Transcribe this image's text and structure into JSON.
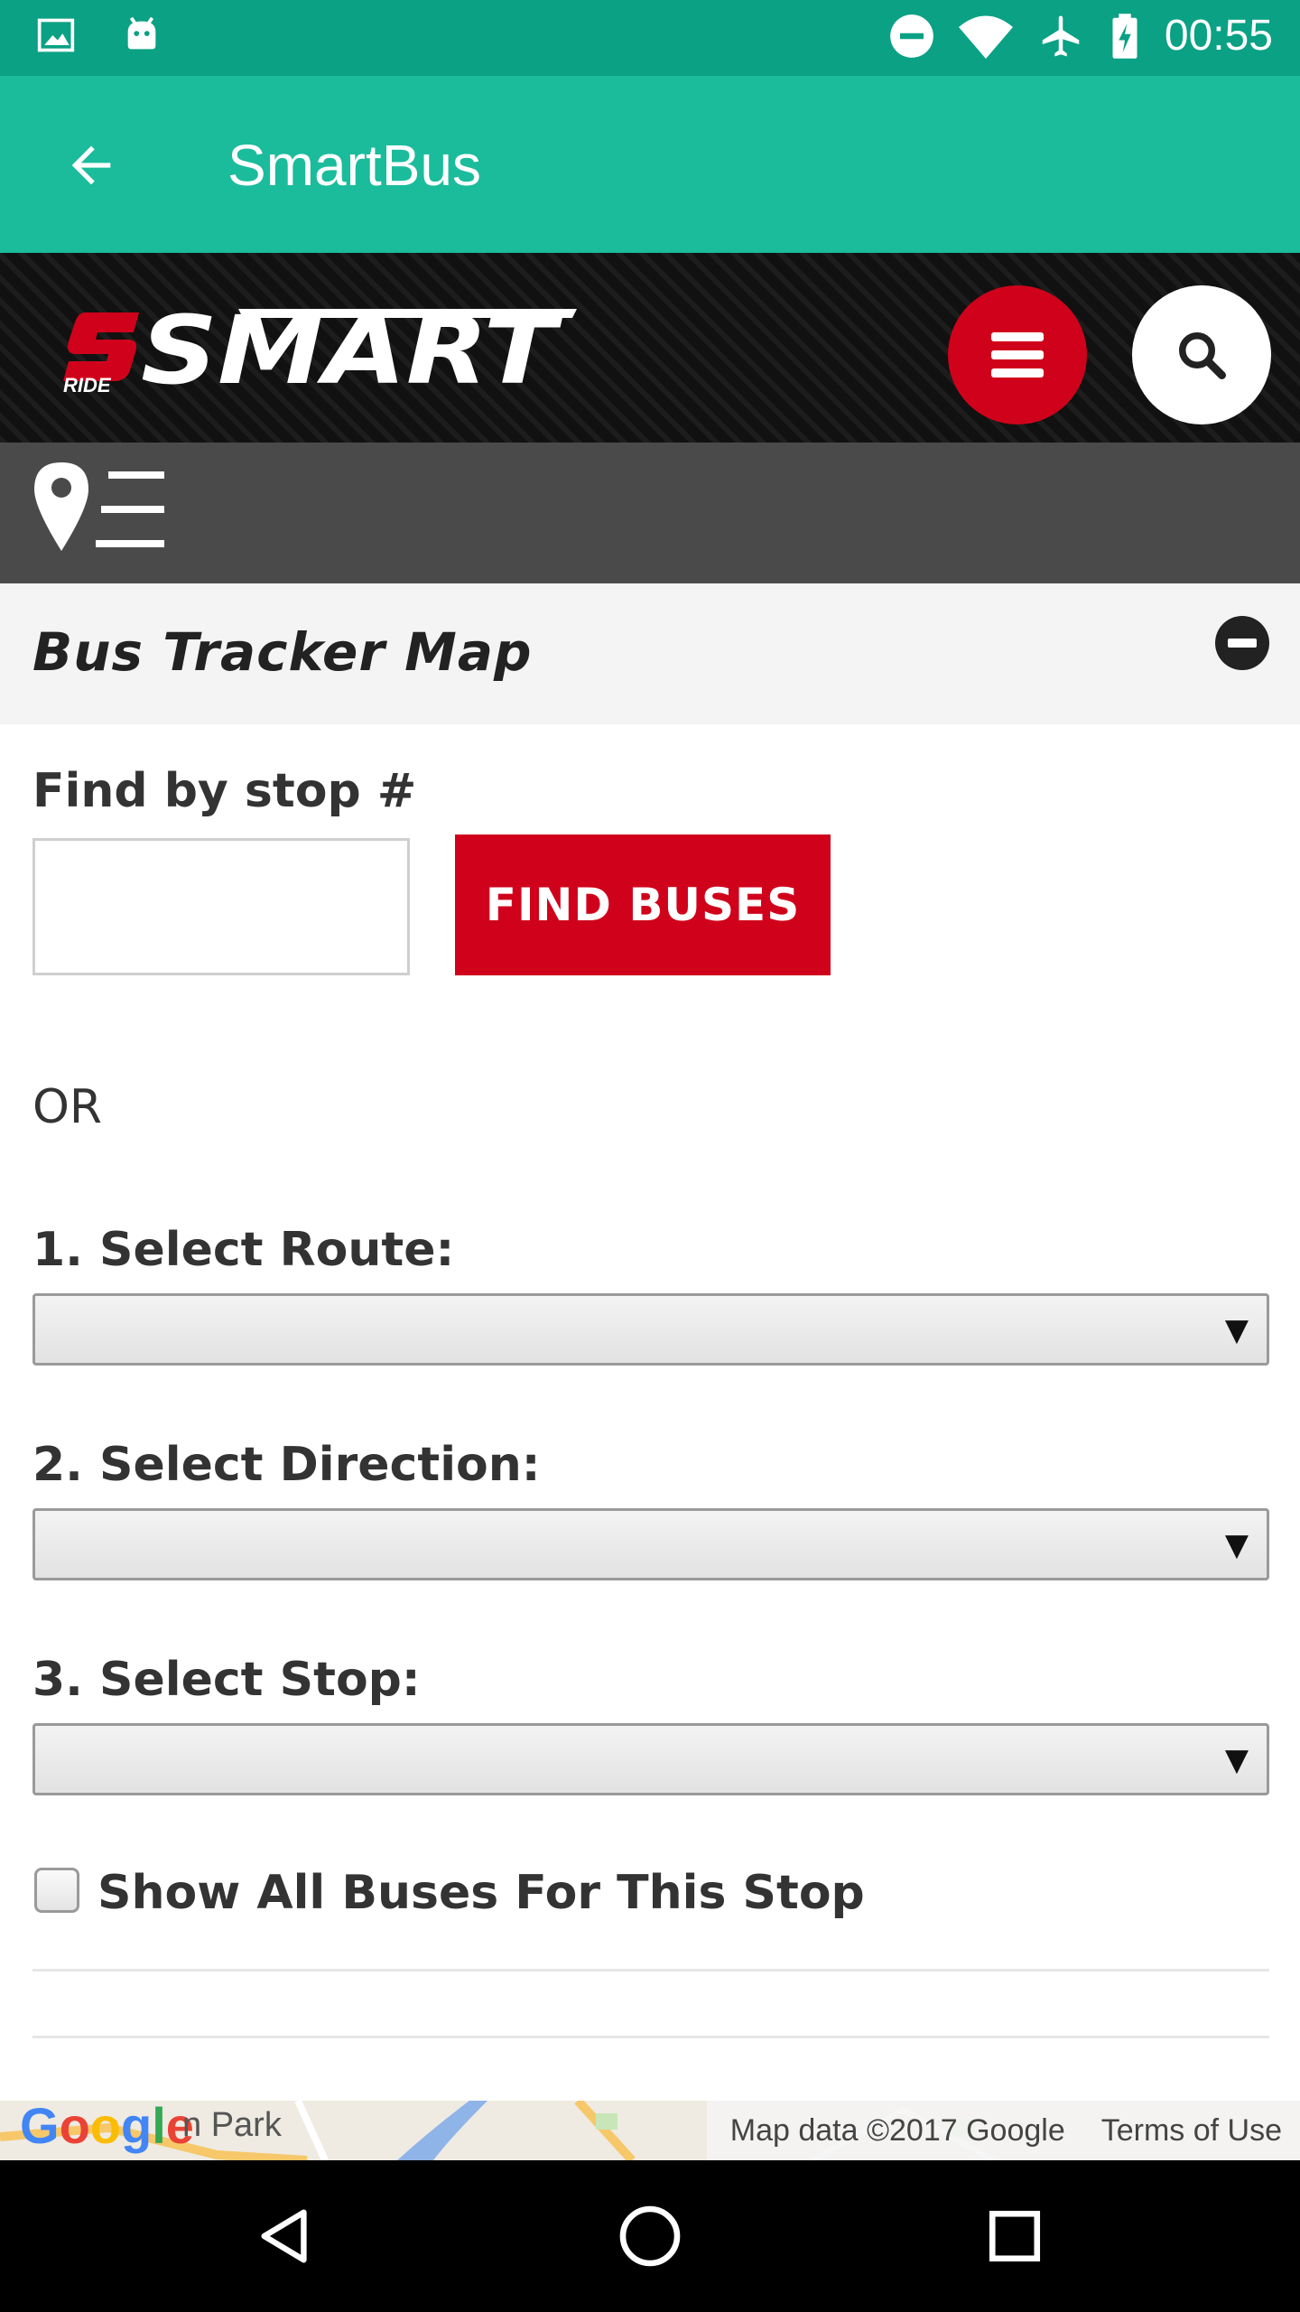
{
  "status_bar": {
    "time": "00:55",
    "icons": [
      "image-icon",
      "android-icon",
      "do-not-disturb-icon",
      "wifi-icon",
      "airplane-icon",
      "battery-charging-icon"
    ]
  },
  "app_bar": {
    "title": "SmartBus",
    "back_icon": "arrow-back-icon",
    "color": "#1abc9c"
  },
  "site_header": {
    "logo_text": "SMART",
    "logo_sub": "RIDE",
    "menu_icon": "hamburger-icon",
    "search_icon": "search-icon",
    "accent": "#d0021b"
  },
  "section": {
    "title": "Bus Tracker Map",
    "collapse_icon": "minus-circle-icon"
  },
  "form": {
    "stop_label": "Find by stop #",
    "stop_value": "",
    "find_button": "FIND BUSES",
    "or_text": "OR",
    "route_label": "1. Select Route:",
    "route_value": "",
    "direction_label": "2. Select Direction:",
    "direction_value": "",
    "stop_select_label": "3. Select Stop:",
    "stop_select_value": "",
    "show_all_label": "Show All Buses For This Stop",
    "show_all_checked": false
  },
  "map": {
    "logo": "Google",
    "place_label": "n Park",
    "attribution": "Map data ©2017 Google",
    "terms": "Terms of Use"
  },
  "nav_bar": {
    "icons": [
      "back-triangle-icon",
      "home-circle-icon",
      "recents-square-icon"
    ]
  }
}
